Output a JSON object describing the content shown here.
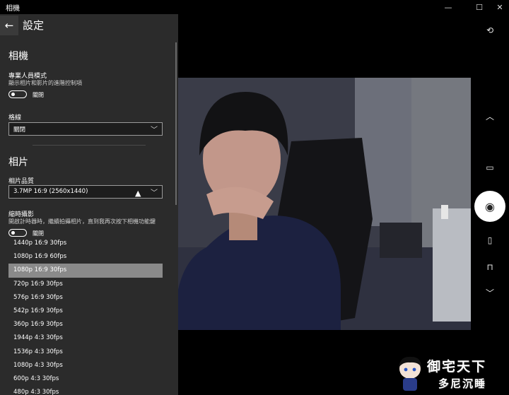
{
  "window": {
    "title": "相機"
  },
  "settings": {
    "header": "設定",
    "camera_section": "相機",
    "pro_mode": {
      "label": "專業人員模式",
      "description": "顯示相片和影片的進階控制項",
      "state": "關閉"
    },
    "grid": {
      "label": "格線",
      "value": "關閉"
    },
    "photo_section": "相片",
    "photo_quality": {
      "label": "相片品質",
      "value": "3.7MP 16:9 (2560x1440)"
    },
    "timelapse": {
      "label": "縮時攝影",
      "description": "開啟計時器時，繼續拍攝相片，直到我再次按下相機功能鍵",
      "state": "關閉"
    },
    "quality_options": [
      "1440p 16:9 30fps",
      "1080p 16:9 60fps",
      "1080p 16:9 30fps",
      "720p 16:9 30fps",
      "576p 16:9 30fps",
      "542p 16:9 30fps",
      "360p 16:9 30fps",
      "1944p 4:3 30fps",
      "1536p 4:3 30fps",
      "1080p 4:3 30fps",
      "600p 4:3 30fps",
      "480p 4:3 30fps"
    ],
    "selected_option": "1080p 16:9 30fps"
  },
  "watermark": {
    "line1": "御宅天下",
    "line2": "多尼沉睡"
  },
  "icons": {
    "back": "arrow-left-icon",
    "minimize": "minimize-icon",
    "maximize": "maximize-icon",
    "close": "close-icon",
    "camera_switch": "camera-switch-icon",
    "chevron_up": "chevron-up-icon",
    "video": "video-camera-icon",
    "photo": "camera-icon",
    "document": "document-icon",
    "whiteboard": "whiteboard-icon",
    "chevron_down": "chevron-down-icon"
  },
  "colors": {
    "panel_bg": "#2b2b2b",
    "selected_bg": "#8a8a8a",
    "window_bg": "#000000"
  }
}
